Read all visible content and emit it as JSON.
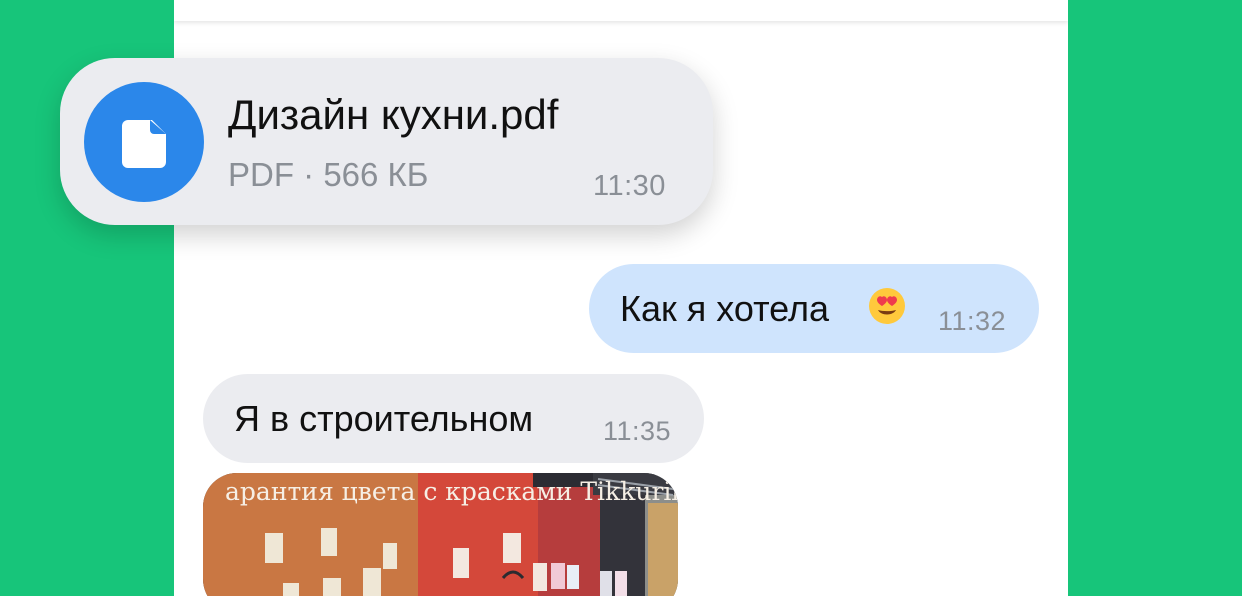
{
  "colors": {
    "background": "#17c57a",
    "incoming_bubble": "#ebecf0",
    "outgoing_bubble": "#cfe4fd",
    "file_icon": "#2b87ea",
    "time_text": "#8a8f96"
  },
  "file_message": {
    "icon": "document-icon",
    "name": "Дизайн кухни.pdf",
    "meta": "PDF · 566 КБ",
    "time": "11:30"
  },
  "messages": [
    {
      "direction": "outgoing",
      "text": "Как я хотела",
      "emoji": "heart-eyes-emoji",
      "time": "11:32"
    },
    {
      "direction": "incoming",
      "text": "Я в строительном",
      "time": "11:35"
    }
  ],
  "photo_message": {
    "caption": "арантия цвета с красками Tikkurila"
  }
}
